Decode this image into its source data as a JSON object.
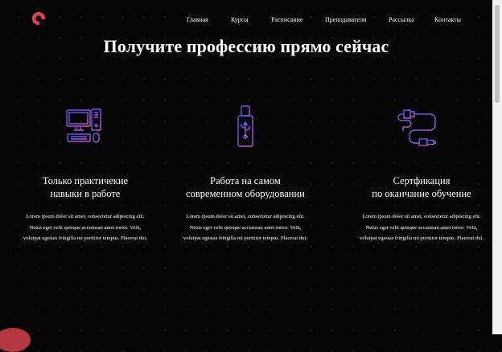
{
  "header": {
    "logo_icon": "logo-icon",
    "nav": [
      {
        "label": "Главная"
      },
      {
        "label": "Курсы"
      },
      {
        "label": "Расписание"
      },
      {
        "label": "Преподаватели"
      },
      {
        "label": "Рассылка"
      },
      {
        "label": "Контакты"
      }
    ]
  },
  "hero": {
    "title": "Получите профессию прямо сейчас"
  },
  "features": [
    {
      "icon": "computer-icon",
      "title": "Только практичекие\nнавыки в работе",
      "desc": "Lorem ipsum dolor sit amet, consectetur adipiscing elit. Netus eget velit quisque accumsan amet tortor. Velit, volutpat egestas fringilla mi porttitor tempus. Placerat dui."
    },
    {
      "icon": "usb-drive-icon",
      "title": "Работа на самом\nсовременном оборудовании",
      "desc": "Lorem ipsum dolor sit amet, consectetur adipiscing elit. Netus eget velit quisque accumsan amet tortor. Velit, volutpat egestas fringilla mi porttitor tempus. Placerat dui."
    },
    {
      "icon": "cable-icon",
      "title": "Сертфикация\nпо оканчание обучение",
      "desc": "Lorem ipsum dolor sit amet, consectetur adipiscing elit. Netus eget velit quisque accumsan amet tortor. Velit, volutpat egestas fringilla mi porttitor tempus. Placerat dui."
    }
  ],
  "colors": {
    "background": "#050505",
    "icon_gradient_start": "#5b4bff",
    "icon_gradient_end": "#c45cd6",
    "logo": "#d9414c"
  }
}
